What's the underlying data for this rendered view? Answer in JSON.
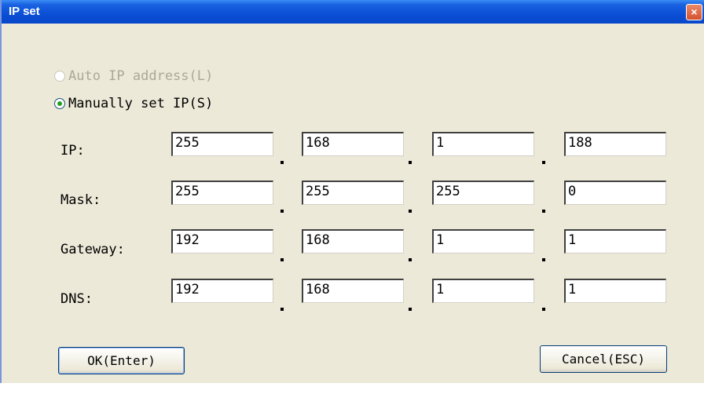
{
  "window": {
    "title": "IP set",
    "close_label": "×"
  },
  "mode": {
    "auto_label": "Auto IP address(L)",
    "manual_label": "Manually set IP(S)",
    "selected": "manual",
    "auto_enabled": false
  },
  "fields": {
    "ip": {
      "label": "IP:",
      "octets": [
        "255",
        "168",
        "1",
        "188"
      ]
    },
    "mask": {
      "label": "Mask:",
      "octets": [
        "255",
        "255",
        "255",
        "0"
      ]
    },
    "gateway": {
      "label": "Gateway:",
      "octets": [
        "192",
        "168",
        "1",
        "1"
      ]
    },
    "dns": {
      "label": "DNS:",
      "octets": [
        "192",
        "168",
        "1",
        "1"
      ]
    }
  },
  "buttons": {
    "ok": "OK(Enter)",
    "cancel": "Cancel(ESC)"
  }
}
